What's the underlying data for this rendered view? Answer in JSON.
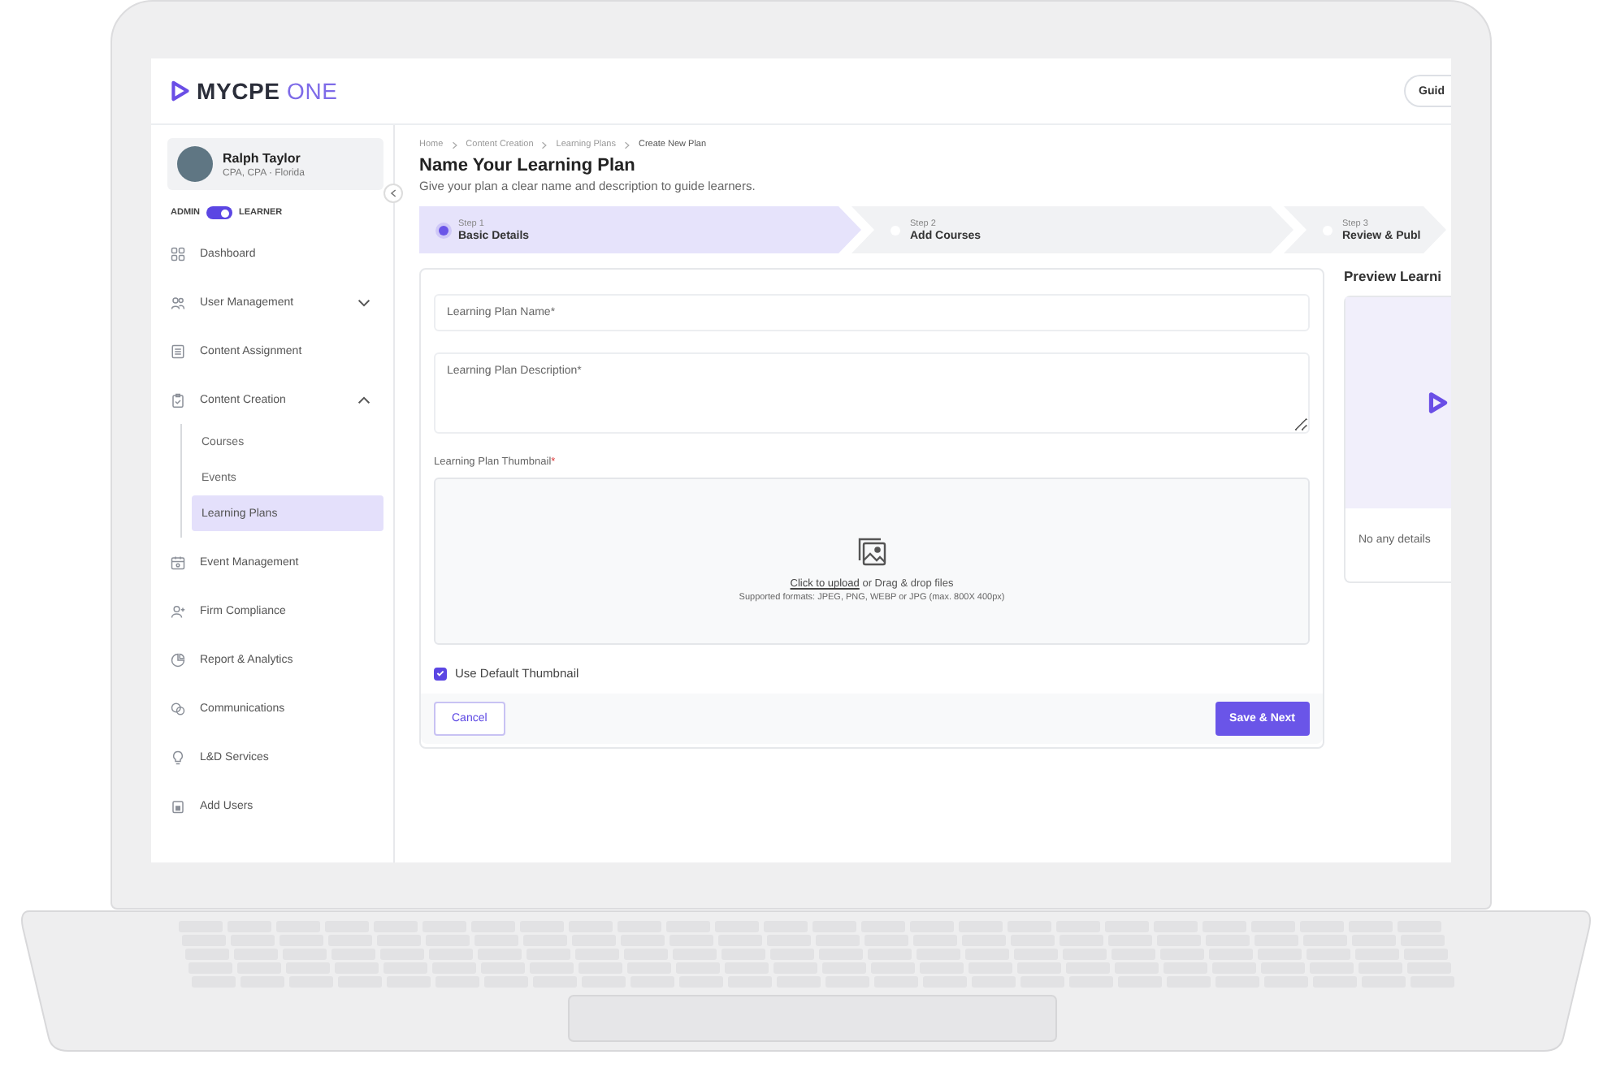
{
  "header": {
    "logo_primary": "MYCPE",
    "logo_secondary": "ONE",
    "button": "Guid"
  },
  "profile": {
    "name": "Ralph Taylor",
    "subtitle": "CPA, CPA · Florida"
  },
  "role_toggle": {
    "left_label": "ADMIN",
    "right_label": "LEARNER",
    "on": true
  },
  "sidebar": {
    "items": [
      {
        "kind": "link",
        "label": "Dashboard"
      },
      {
        "kind": "group",
        "label": "User Management",
        "expanded": false
      },
      {
        "kind": "link",
        "label": "Content Assignment"
      },
      {
        "kind": "group",
        "label": "Content Creation",
        "expanded": true,
        "children": [
          {
            "label": "Courses",
            "selected": false
          },
          {
            "label": "Events",
            "selected": false
          },
          {
            "label": "Learning Plans",
            "selected": true
          }
        ]
      },
      {
        "kind": "link",
        "label": "Event Management"
      },
      {
        "kind": "link",
        "label": "Firm Compliance"
      },
      {
        "kind": "link",
        "label": "Report & Analytics"
      },
      {
        "kind": "link",
        "label": "Communications"
      },
      {
        "kind": "link",
        "label": "L&D Services"
      },
      {
        "kind": "link",
        "label": "Add Users"
      }
    ]
  },
  "breadcrumb": [
    "Home",
    "Content Creation",
    "Learning Plans",
    "Create New Plan"
  ],
  "title": "Name Your Learning Plan",
  "subtitle": "Give your plan a clear name and description to guide learners.",
  "steps": [
    {
      "step": "Step 1",
      "label": "Basic Details",
      "selected": true
    },
    {
      "step": "Step 2",
      "label": "Add Courses",
      "selected": false
    },
    {
      "step": "Step 3",
      "label": "Review & Publ",
      "selected": false
    }
  ],
  "form": {
    "name_field": {
      "placeholder": "Learning Plan Name*"
    },
    "description_field": {
      "placeholder": "Learning Plan Description*"
    },
    "thumbnail_label": "Learning Plan Thumbnail",
    "required_mark": "*",
    "upload": {
      "link": "Click to upload",
      "text": "or Drag & drop files",
      "formats": "Supported formats: JPEG, PNG, WEBP or JPG (max. 800X 400px)"
    },
    "default_thumbnail": {
      "label": "Use Default Thumbnail",
      "checked": true
    },
    "buttons": {
      "cancel": "Cancel",
      "save": "Save & Next"
    }
  },
  "preview": {
    "title": "Preview Learni",
    "empty_text": "No any details"
  }
}
